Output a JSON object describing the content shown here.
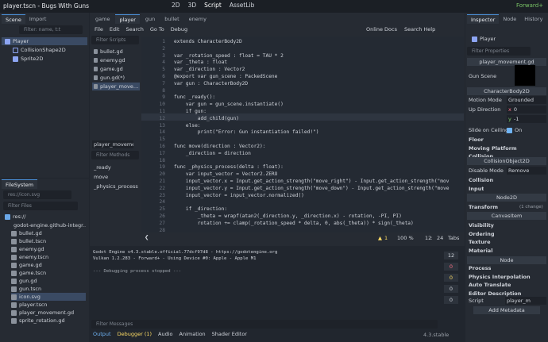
{
  "app": {
    "title": "player.tscn - Bugs With Guns",
    "workspaces": [
      "2D",
      "3D",
      "Script",
      "AssetLib"
    ],
    "renderer": "Forward+"
  },
  "scene_dock": {
    "tabs": [
      "Scene",
      "Import"
    ],
    "filter_placeholder": "Filter: name, t:t",
    "nodes": [
      "Player",
      "CollisionShape2D",
      "Sprite2D"
    ]
  },
  "filesystem": {
    "tab": "FileSystem",
    "path": "res://icon.svg",
    "filter_placeholder": "Filter Files",
    "root": "res://",
    "items": [
      "godot-engine.github-integr…",
      "bullet.gd",
      "bullet.tscn",
      "enemy.gd",
      "enemy.tscn",
      "game.gd",
      "game.tscn",
      "gun.gd",
      "gun.tscn",
      "icon.svg",
      "player.tscn",
      "player_movement.gd",
      "sprite_rotation.gd"
    ]
  },
  "editor": {
    "tabs": [
      "game",
      "player",
      "gun",
      "bullet",
      "enemy"
    ],
    "menu": [
      "File",
      "Edit",
      "Search",
      "Go To",
      "Debug"
    ],
    "online_docs": "Online Docs",
    "search_help": "Search Help",
    "filter_scripts": "Filter Scripts",
    "scripts": [
      "bullet.gd",
      "enemy.gd",
      "game.gd",
      "gun.gd(*)",
      "player_move…"
    ],
    "current_script": "player_movemen",
    "filter_methods": "Filter Methods",
    "methods": [
      "_ready",
      "move",
      "_physics_process"
    ],
    "lines": [
      {
        "n": "1",
        "t": "extends CharacterBody2D"
      },
      {
        "n": "2",
        "t": ""
      },
      {
        "n": "3",
        "t": "var _rotation_speed : float = TAU * 2"
      },
      {
        "n": "4",
        "t": "var _theta : float"
      },
      {
        "n": "5",
        "t": "var _direction : Vector2"
      },
      {
        "n": "6",
        "t": "@export var gun_scene : PackedScene"
      },
      {
        "n": "7",
        "t": "var gun : CharacterBody2D"
      },
      {
        "n": "8",
        "t": ""
      },
      {
        "n": "9",
        "t": "func _ready():"
      },
      {
        "n": "10",
        "t": "    var gun = gun_scene.instantiate()"
      },
      {
        "n": "11",
        "t": "    if gun:"
      },
      {
        "n": "12",
        "t": "        add_child(gun)"
      },
      {
        "n": "13",
        "t": "    else:"
      },
      {
        "n": "14",
        "t": "        print(\"Error: Gun instantiation failed!\")"
      },
      {
        "n": "15",
        "t": ""
      },
      {
        "n": "16",
        "t": "func move(direction : Vector2):"
      },
      {
        "n": "17",
        "t": "    _direction = direction"
      },
      {
        "n": "18",
        "t": ""
      },
      {
        "n": "19",
        "t": "func _physics_process(delta : float):"
      },
      {
        "n": "20",
        "t": "    var input_vector = Vector2.ZERO"
      },
      {
        "n": "21",
        "t": "    input_vector.x = Input.get_action_strength(\"move_right\") - Input.get_action_strength(\"mov"
      },
      {
        "n": "22",
        "t": "    input_vector.y = Input.get_action_strength(\"move_down\") - Input.get_action_strength(\"move"
      },
      {
        "n": "23",
        "t": "    input_vector = input_vector.normalized()"
      },
      {
        "n": "24",
        "t": ""
      },
      {
        "n": "25",
        "t": "    if _direction:"
      },
      {
        "n": "26",
        "t": "        _theta = wrapf(atan2(_direction.y, _direction.x) - rotation, -PI, PI)"
      },
      {
        "n": "27",
        "t": "        rotation += clamp(_rotation_speed * delta, 0, abs(_theta)) * sign(_theta)"
      },
      {
        "n": "28",
        "t": ""
      }
    ],
    "status": {
      "warn": "1",
      "zoom": "100 %",
      "line": "12",
      "col": "24",
      "tabs": "Tabs"
    }
  },
  "output": {
    "lines": [
      "Godot Engine v4.3.stable.official.77dcf97d8 - https://godotengine.org",
      "Vulkan 1.2.283 - Forward+ - Using Device #0: Apple - Apple M1",
      "",
      "--- Debugging process stopped ---"
    ],
    "filter_placeholder": "Filter Messages",
    "counts": [
      "12",
      "0",
      "0",
      "0",
      "0"
    ],
    "bottom_tabs": [
      "Output",
      "Debugger (1)",
      "Audio",
      "Animation",
      "Shader Editor"
    ],
    "version": "4.3.stable"
  },
  "inspector": {
    "tabs": [
      "Inspector",
      "Node",
      "History"
    ],
    "node": "Player",
    "filter_placeholder": "Filter Properties",
    "script": "player_movement.gd",
    "gun_scene_label": "Gun Scene",
    "class1": "CharacterBody2D",
    "motion_mode_label": "Motion Mode",
    "motion_mode": "Grounded",
    "up_direction_label": "Up Direction",
    "up_x": "0",
    "up_y": "-1",
    "slide_label": "Slide on Ceiling",
    "slide_value": "On",
    "sections1": [
      "Floor",
      "Moving Platform",
      "Collision"
    ],
    "class2": "CollisionObject2D",
    "disable_mode_label": "Disable Mode",
    "disable_mode": "Remove",
    "sections2": [
      "Collision",
      "Input"
    ],
    "class3": "Node2D",
    "transform": "Transform",
    "changed": "(1 change)",
    "class4": "CanvasItem",
    "sections3": [
      "Visibility",
      "Ordering",
      "Texture",
      "Material"
    ],
    "class5": "Node",
    "sections4": [
      "Process",
      "Physics Interpolation",
      "Auto Translate",
      "Editor Description"
    ],
    "script_label": "Script",
    "script_value": "player_m",
    "add_metadata": "Add Metadata"
  }
}
